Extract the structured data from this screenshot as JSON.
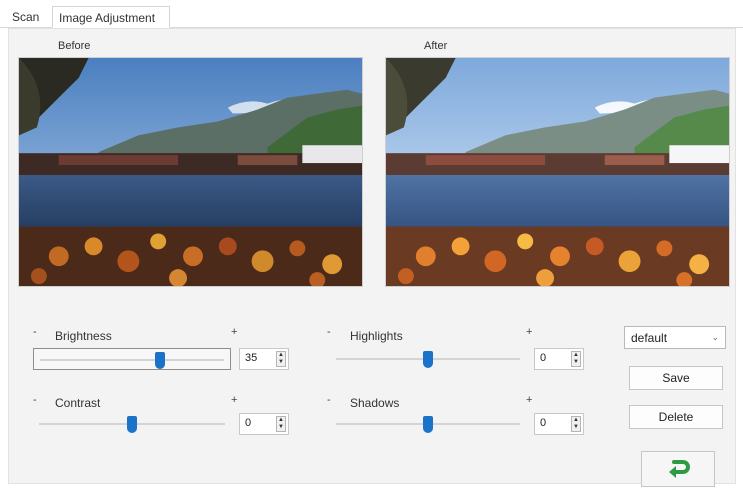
{
  "tabs": {
    "scan": "Scan",
    "image_adjustment": "Image Adjustment"
  },
  "preview": {
    "before_label": "Before",
    "after_label": "After"
  },
  "sliders": {
    "minus": "-",
    "plus": "+",
    "brightness": {
      "label": "Brightness",
      "value": "35",
      "level": 0.65
    },
    "contrast": {
      "label": "Contrast",
      "value": "0",
      "level": 0.5
    },
    "highlights": {
      "label": "Highlights",
      "value": "0",
      "level": 0.5
    },
    "shadows": {
      "label": "Shadows",
      "value": "0",
      "level": 0.5
    }
  },
  "preset": {
    "selected": "default",
    "save_label": "Save",
    "delete_label": "Delete"
  },
  "icons": {
    "apply": "apply-arrow-icon",
    "spin_up": "spin-up-icon",
    "spin_down": "spin-down-icon",
    "dropdown": "chevron-down-icon"
  },
  "colors": {
    "accent": "#1a73c9",
    "apply_icon": "#2f9a44"
  }
}
